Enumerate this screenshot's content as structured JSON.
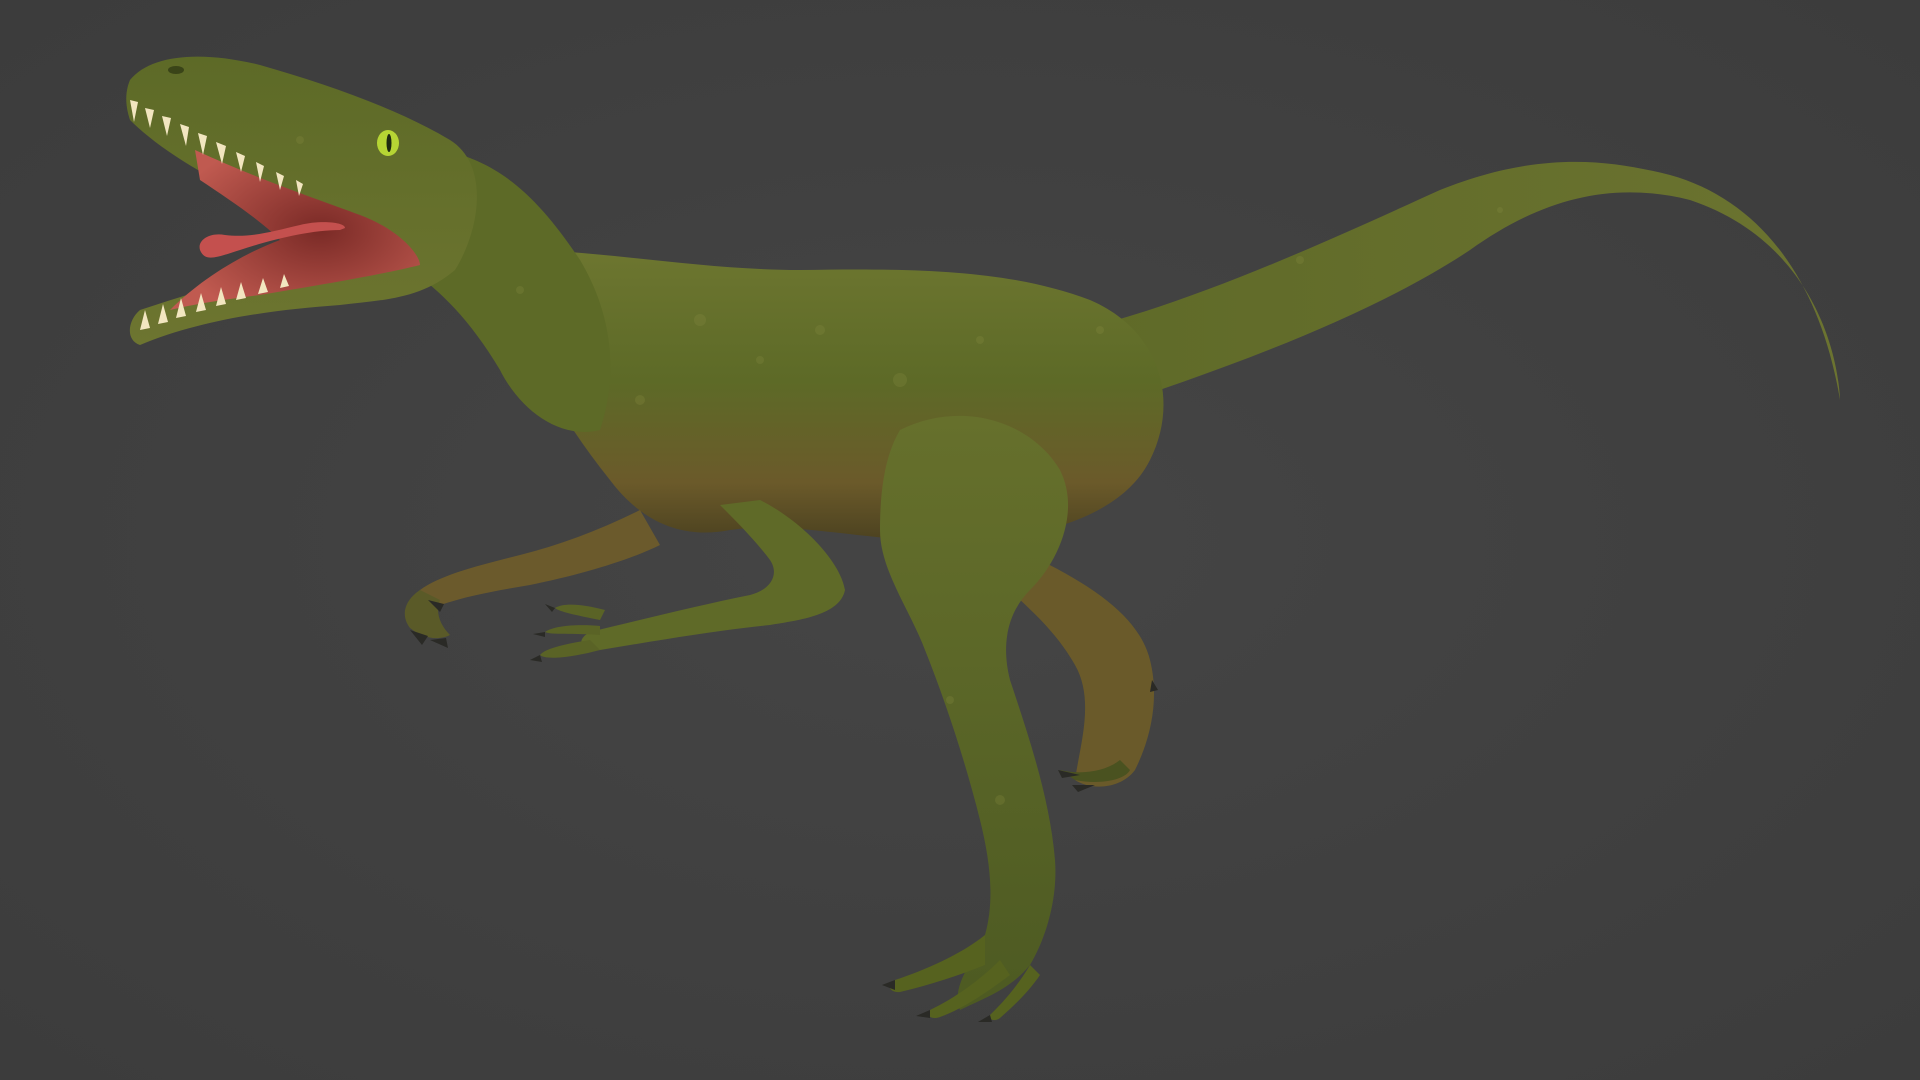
{
  "scene": {
    "background_color": "#404040",
    "subject": "dinosaur-render",
    "colors": {
      "skin_light": "#7a7f35",
      "skin_mid": "#5f6a28",
      "skin_dark": "#3f4a1c",
      "belly": "#7b5a2c",
      "mouth": "#b8504a",
      "tongue": "#c4504e",
      "teeth": "#f2e6c0",
      "eye": "#b6d534",
      "claws": "#2a2a26"
    }
  }
}
